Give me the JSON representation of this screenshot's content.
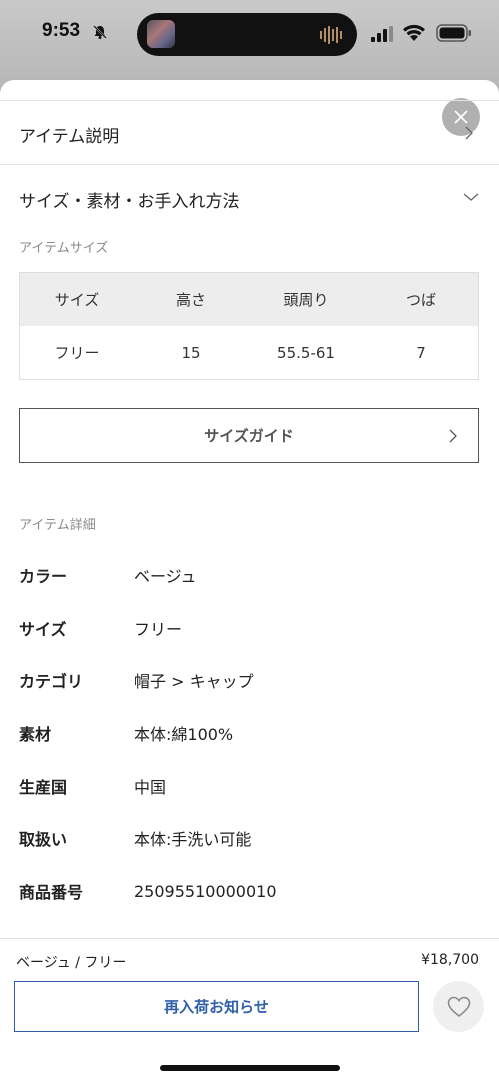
{
  "status_bar": {
    "time": "9:53"
  },
  "sheet": {
    "item_description": "アイテム説明",
    "size_material_care": "サイズ・素材・お手入れ方法",
    "item_size_label": "アイテムサイズ",
    "size_table": {
      "headers": [
        "サイズ",
        "高さ",
        "頭周り",
        "つば"
      ],
      "rows": [
        [
          "フリー",
          "15",
          "55.5-61",
          "7"
        ]
      ]
    },
    "size_guide_label": "サイズガイド",
    "item_details_label": "アイテム詳細",
    "details": [
      {
        "key": "カラー",
        "value": "ベージュ"
      },
      {
        "key": "サイズ",
        "value": "フリー"
      },
      {
        "key": "カテゴリ",
        "value": "帽子 > キャップ"
      },
      {
        "key": "素材",
        "value": "本体:綿100%"
      },
      {
        "key": "生産国",
        "value": "中国"
      },
      {
        "key": "取扱い",
        "value": "本体:手洗い可能"
      },
      {
        "key": "商品番号",
        "value": "25095510000010"
      }
    ]
  },
  "footer": {
    "variant": "ベージュ / フリー",
    "price": "¥18,700",
    "restock_label": "再入荷お知らせ"
  },
  "colors": {
    "accent": "#2f5fa8",
    "table_header_bg": "#ededed",
    "close_button_bg": "#b0b0b0"
  }
}
